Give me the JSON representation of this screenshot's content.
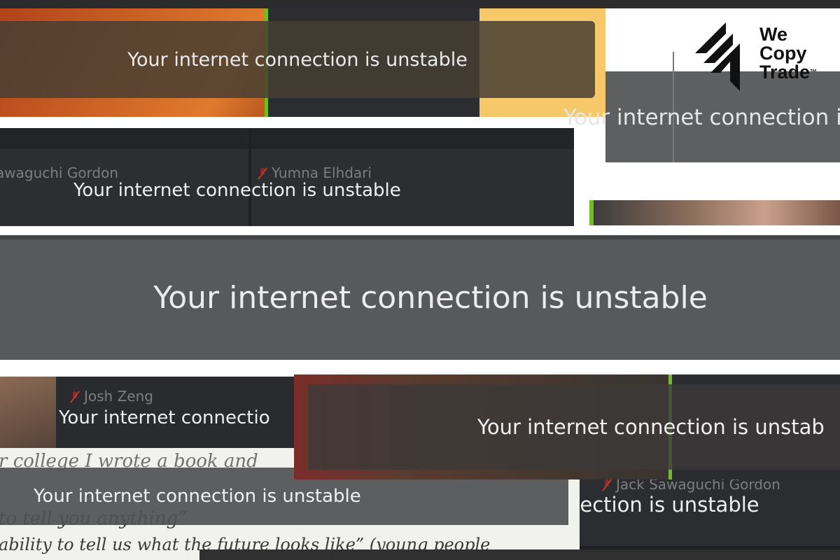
{
  "notice": {
    "unstable": "Your internet connection is unstable",
    "cut_1": "Your internet connectio",
    "cut_2": "Your internet connectio",
    "cut_3": "Your internet connection is unstab",
    "cut_4": "nection is unstable"
  },
  "participants": {
    "p1": "awaguchi Gordon",
    "p2": "Yumna Elhdari",
    "p3": "Josh Zeng",
    "p4": "Jack Sawaguchi Gordon"
  },
  "background_text": {
    "line1": "r college I wrote a book and",
    "line2": "to tell you anything”",
    "line3": "ability to tell us what the future looks like” (young people"
  },
  "logo": {
    "line1": "We",
    "line2": "Copy",
    "line3": "Trade",
    "tm": "™"
  },
  "colors": {
    "bar_dark": "#2f3033",
    "bar_mid": "#5a5b5d",
    "accent_green": "#6fbf1f",
    "warm": "#c7541f",
    "gold": "#f6c86a"
  }
}
